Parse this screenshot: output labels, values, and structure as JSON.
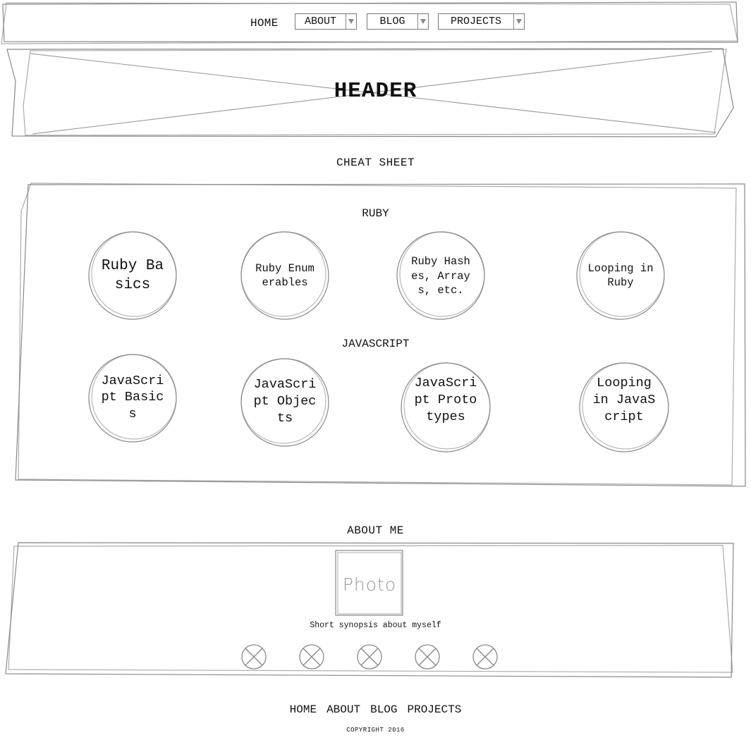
{
  "nav": {
    "home": "HOME",
    "about": "ABOUT",
    "blog": "BLOG",
    "projects": "PROJECTS"
  },
  "header": {
    "title": "HEADER"
  },
  "cheat_sheet": {
    "title": "CHEAT SHEET",
    "ruby": {
      "title": "RUBY",
      "items": [
        "Ruby Basics",
        "Ruby Enumerables",
        "Ruby Hashes, Arrays, etc.",
        "Looping in Ruby"
      ]
    },
    "javascript": {
      "title": "JAVASCRIPT",
      "items": [
        "JavaScript Basics",
        "JavaScript Objects",
        "JavaScript Prototypes",
        "Looping in JavaScript"
      ]
    }
  },
  "about_me": {
    "title": "ABOUT ME",
    "photo": "Photo",
    "synopsis": "Short synopsis about myself"
  },
  "footer": {
    "links": [
      "HOME",
      "ABOUT",
      "BLOG",
      "PROJECTS"
    ],
    "copyright": "COPYRIGHT 2016"
  }
}
